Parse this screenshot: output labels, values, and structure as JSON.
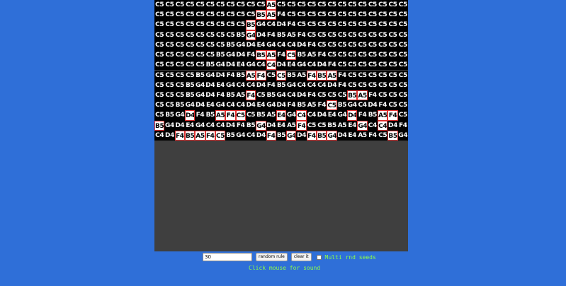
{
  "grid": {
    "rows": [
      [
        "C5",
        "C5",
        "C5",
        "C5",
        "C5",
        "C5",
        "C5",
        "C5",
        "C5",
        "C5",
        "C5",
        "A5",
        "C5",
        "C5",
        "C5",
        "C5",
        "C5",
        "C5",
        "C5",
        "C5",
        "C5",
        "C5",
        "C5",
        "C5",
        "C5"
      ],
      [
        "C5",
        "C5",
        "C5",
        "C5",
        "C5",
        "C5",
        "C5",
        "C5",
        "C5",
        "C5",
        "B5",
        "A5",
        "F4",
        "C5",
        "C5",
        "C5",
        "C5",
        "C5",
        "C5",
        "C5",
        "C5",
        "C5",
        "C5",
        "C5",
        "C5"
      ],
      [
        "C5",
        "C5",
        "C5",
        "C5",
        "C5",
        "C5",
        "C5",
        "C5",
        "C5",
        "B5",
        "G4",
        "C4",
        "D4",
        "F4",
        "C5",
        "C5",
        "C5",
        "C5",
        "C5",
        "C5",
        "C5",
        "C5",
        "C5",
        "C5",
        "C5"
      ],
      [
        "C5",
        "C5",
        "C5",
        "C5",
        "C5",
        "C5",
        "C5",
        "C5",
        "B5",
        "G4",
        "D4",
        "F4",
        "B5",
        "A5",
        "F4",
        "C5",
        "C5",
        "C5",
        "C5",
        "C5",
        "C5",
        "C5",
        "C5",
        "C5",
        "C5"
      ],
      [
        "C5",
        "C5",
        "C5",
        "C5",
        "C5",
        "C5",
        "C5",
        "B5",
        "G4",
        "D4",
        "E4",
        "G4",
        "C4",
        "C4",
        "D4",
        "F4",
        "C5",
        "C5",
        "C5",
        "C5",
        "C5",
        "C5",
        "C5",
        "C5",
        "C5"
      ],
      [
        "C5",
        "C5",
        "C5",
        "C5",
        "C5",
        "C5",
        "B5",
        "G4",
        "D4",
        "F4",
        "B5",
        "A5",
        "F4",
        "C5",
        "B5",
        "A5",
        "F4",
        "C5",
        "C5",
        "C5",
        "C5",
        "C5",
        "C5",
        "C5",
        "C5"
      ],
      [
        "C5",
        "C5",
        "C5",
        "C5",
        "C5",
        "B5",
        "G4",
        "D4",
        "E4",
        "G4",
        "C4",
        "C4",
        "D4",
        "E4",
        "G4",
        "C4",
        "D4",
        "F4",
        "C5",
        "C5",
        "C5",
        "C5",
        "C5",
        "C5",
        "C5"
      ],
      [
        "C5",
        "C5",
        "C5",
        "C5",
        "B5",
        "G4",
        "D4",
        "F4",
        "B5",
        "A5",
        "F4",
        "C5",
        "C5",
        "B5",
        "A5",
        "F4",
        "B5",
        "A5",
        "F4",
        "C5",
        "C5",
        "C5",
        "C5",
        "C5",
        "C5"
      ],
      [
        "C5",
        "C5",
        "C5",
        "B5",
        "G4",
        "D4",
        "E4",
        "G4",
        "C4",
        "C4",
        "D4",
        "F4",
        "B5",
        "G4",
        "C4",
        "C4",
        "C4",
        "D4",
        "F4",
        "C5",
        "C5",
        "C5",
        "C5",
        "C5",
        "C5"
      ],
      [
        "C5",
        "C5",
        "C5",
        "B5",
        "G4",
        "D4",
        "F4",
        "B5",
        "A5",
        "F4",
        "C5",
        "B5",
        "G4",
        "C4",
        "D4",
        "F4",
        "C5",
        "C5",
        "C5",
        "B5",
        "A5",
        "F4",
        "C5",
        "C5",
        "C5"
      ],
      [
        "C5",
        "C5",
        "B5",
        "G4",
        "D4",
        "E4",
        "G4",
        "C4",
        "C4",
        "D4",
        "E4",
        "G4",
        "D4",
        "F4",
        "B5",
        "A5",
        "F4",
        "C5",
        "B5",
        "G4",
        "C4",
        "D4",
        "F4",
        "C5",
        "C5"
      ],
      [
        "C5",
        "B5",
        "G4",
        "D4",
        "F4",
        "B5",
        "A5",
        "F4",
        "C5",
        "C5",
        "B5",
        "A5",
        "E4",
        "G4",
        "C4",
        "C4",
        "D4",
        "E4",
        "G4",
        "D4",
        "F4",
        "B5",
        "A5",
        "F4",
        "C5"
      ],
      [
        "B5",
        "G4",
        "D4",
        "E4",
        "G4",
        "C4",
        "C4",
        "D4",
        "F4",
        "B5",
        "G4",
        "D4",
        "E4",
        "A5",
        "F4",
        "C5",
        "C5",
        "B5",
        "A5",
        "E4",
        "G4",
        "C4",
        "C4",
        "D4",
        "F4"
      ],
      [
        "C4",
        "D4",
        "F4",
        "B5",
        "A5",
        "F4",
        "C5",
        "B5",
        "G4",
        "C4",
        "D4",
        "F4",
        "B5",
        "G4",
        "D4",
        "F4",
        "B5",
        "G4",
        "D4",
        "E4",
        "A5",
        "F4",
        "C5",
        "B5",
        "G4"
      ]
    ],
    "on": [
      "1111111111101111111111111",
      "1111111111001111111111111",
      "1111111110111111111111111",
      "1111111110111111111111111",
      "1111111111111111111111111",
      "1111111111001011111111111",
      "1111111111101111111111111",
      "1111111110010110001111111",
      "1111111111111111111111111",
      "1111111110111111111001111",
      "1111111111111111101111111",
      "1110110001110101111011001",
      "0111111111011101111101011",
      "1100000111101010001111101"
    ]
  },
  "controls": {
    "rule_value": "30",
    "random_rule_label": "random rule",
    "clear_label": "clear it",
    "multi_seeds_label": "Multi rnd seeds"
  },
  "hint": "Click mouse for sound"
}
